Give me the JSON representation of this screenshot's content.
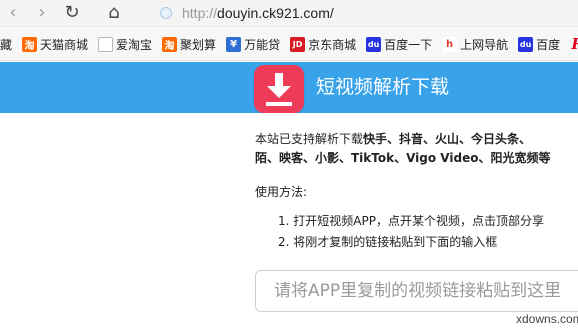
{
  "browser": {
    "url_prefix": "http://",
    "url_host": "douyin.ck921.com/",
    "back_glyph": "‹",
    "forward_glyph": "›",
    "reload_glyph": "↻",
    "home_glyph": "⌂"
  },
  "bookmarks": [
    {
      "label": "藏",
      "icon": "folder-icon"
    },
    {
      "label": "天猫商城",
      "icon": "taobao-icon",
      "glyph": "淘"
    },
    {
      "label": "爱淘宝",
      "icon": "page-icon",
      "glyph": ""
    },
    {
      "label": "聚划算",
      "icon": "taobao-icon",
      "glyph": "淘"
    },
    {
      "label": "万能贷",
      "icon": "wanneng-icon",
      "glyph": "¥"
    },
    {
      "label": "京东商城",
      "icon": "jd-icon",
      "glyph": "JD"
    },
    {
      "label": "百度一下",
      "icon": "baidu-icon",
      "glyph": "du"
    },
    {
      "label": "上网导航",
      "icon": "hao123-icon",
      "glyph": "h"
    },
    {
      "label": "百度",
      "icon": "baidu-icon",
      "glyph": "du"
    },
    {
      "label": "",
      "icon": "r-logo-icon",
      "glyph": "R"
    }
  ],
  "header": {
    "title": "短视频解析下载",
    "brand_color": "#39a3ea",
    "logo_color": "#ee3b57"
  },
  "intro": {
    "line1_prefix": "本站已支持解析下载",
    "line1_platforms": "快手、抖音、火山、今日头条、",
    "line2_platforms": "陌、映客、小影、TikTok、Vigo Video、阳光宽频等"
  },
  "usage": {
    "title": "使用方法:",
    "steps": [
      "1. 打开短视频APP，点开某个视频，点击顶部分享",
      "2. 将刚才复制的链接粘贴到下面的输入框"
    ]
  },
  "search": {
    "placeholder": "请将APP里复制的视频链接粘贴到这里"
  },
  "watermark": "xdowns.com"
}
